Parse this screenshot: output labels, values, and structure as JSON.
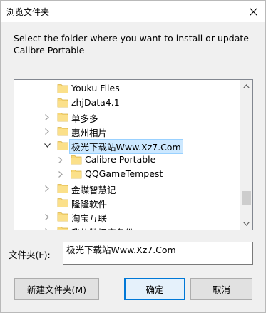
{
  "window": {
    "title": "浏览文件夹"
  },
  "description": "Select the folder where you want to install or update Calibre Portable",
  "tree": {
    "items": [
      {
        "label": "Youku Files",
        "level": 1,
        "expander": "none"
      },
      {
        "label": "zhjData4.1",
        "level": 1,
        "expander": "none"
      },
      {
        "label": "单多多",
        "level": 1,
        "expander": "collapsed"
      },
      {
        "label": "惠州相片",
        "level": 1,
        "expander": "collapsed"
      },
      {
        "label": "极光下载站Www.Xz7.Com",
        "level": 1,
        "expander": "expanded",
        "selected": true
      },
      {
        "label": "Calibre Portable",
        "level": 2,
        "expander": "collapsed"
      },
      {
        "label": "QQGameTempest",
        "level": 2,
        "expander": "collapsed"
      },
      {
        "label": "金蝶智慧记",
        "level": 1,
        "expander": "collapsed"
      },
      {
        "label": "隆隆软件",
        "level": 1,
        "expander": "none"
      },
      {
        "label": "淘宝互联",
        "level": 1,
        "expander": "collapsed"
      },
      {
        "label": "我的数据库备份",
        "level": 1,
        "expander": "collapsed"
      }
    ]
  },
  "folder_field": {
    "label": "文件夹(F):",
    "value": "极光下载站Www.Xz7.Com"
  },
  "buttons": {
    "new_folder": "新建文件夹(M)",
    "ok": "确定",
    "cancel": "取消"
  },
  "colors": {
    "accent": "#0078d7",
    "selection": "#cce8ff",
    "folder": "#f8d775"
  }
}
